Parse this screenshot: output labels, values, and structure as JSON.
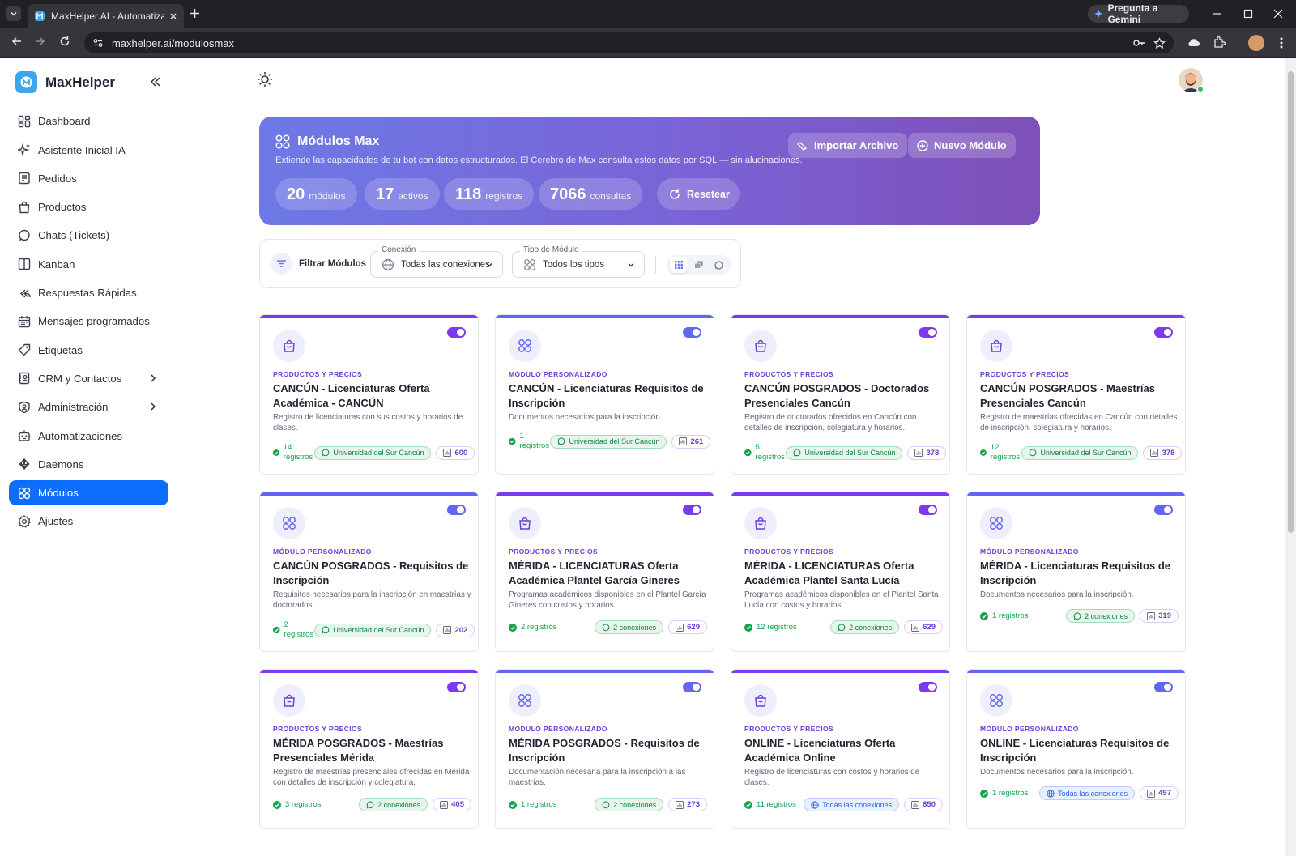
{
  "browser": {
    "tab_title": "MaxHelper.AI - Automatiza tu a",
    "url": "maxhelper.ai/modulosmax",
    "gemini_label": "Pregunta a Gemini"
  },
  "app": {
    "name": "MaxHelper"
  },
  "sidebar": {
    "items": [
      {
        "label": "Dashboard",
        "icon": "dashboard-icon"
      },
      {
        "label": "Asistente Inicial IA",
        "icon": "sparkle-icon"
      },
      {
        "label": "Pedidos",
        "icon": "orders-icon"
      },
      {
        "label": "Productos",
        "icon": "bag-icon"
      },
      {
        "label": "Chats (Tickets)",
        "icon": "whatsapp-icon"
      },
      {
        "label": "Kanban",
        "icon": "kanban-icon"
      },
      {
        "label": "Respuestas Rápidas",
        "icon": "reply-all-icon"
      },
      {
        "label": "Mensajes programados",
        "icon": "calendar-icon"
      },
      {
        "label": "Etiquetas",
        "icon": "tag-icon"
      },
      {
        "label": "CRM y Contactos",
        "icon": "contacts-icon"
      },
      {
        "label": "Administración",
        "icon": "admin-icon"
      },
      {
        "label": "Automatizaciones",
        "icon": "robot-icon"
      },
      {
        "label": "Daemons",
        "icon": "daemon-icon"
      },
      {
        "label": "Módulos",
        "icon": "modules-icon"
      },
      {
        "label": "Ajustes",
        "icon": "settings-icon"
      }
    ]
  },
  "hero": {
    "title": "Módulos Max",
    "subtitle": "Extiende las capacidades de tu bot con datos estructurados. El Cerebro de Max consulta estos datos por SQL — sin alucinaciones.",
    "import_label": "Importar Archivo",
    "new_label": "Nuevo Módulo",
    "stats": [
      {
        "value": "20",
        "unit": "módulos"
      },
      {
        "value": "17",
        "unit": "activos"
      },
      {
        "value": "118",
        "unit": "registros"
      },
      {
        "value": "7066",
        "unit": "consultas"
      }
    ],
    "reset_label": "Resetear"
  },
  "filters": {
    "label": "Filtrar Módulos",
    "connection_legend": "Conexión",
    "connection_value": "Todas las conexiones",
    "type_legend": "Tipo de Módulo",
    "type_value": "Todos los tipos"
  },
  "colors": {
    "primary": "#0d6efd",
    "purple": "#6d3fd6",
    "indigo": "#6366f1",
    "green": "#16a34a"
  },
  "cards": [
    {
      "type": "PRODUCTOS Y PRECIOS",
      "title": "CANCÚN - Licenciaturas Oferta Académica - CANCÚN",
      "desc": "Registro de licenciaturas con sus costos y horarios de clases.",
      "registros": "14 registros",
      "conexion": "Universidad del Sur Cancún",
      "conexion_kind": "wa",
      "count": "600",
      "icon": "bag-icon"
    },
    {
      "type": "MÓDULO PERSONALIZADO",
      "title": "CANCÚN - Licenciaturas Requisitos de Inscripción",
      "desc": "Documentos necesarios para la inscripción.",
      "registros": "1 registros",
      "conexion": "Universidad del Sur Cancún",
      "conexion_kind": "wa",
      "count": "261",
      "icon": "modules-icon"
    },
    {
      "type": "PRODUCTOS Y PRECIOS",
      "title": "CANCÚN POSGRADOS - Doctorados Presenciales Cancún",
      "desc": "Registro de doctorados ofrecidos en Cancún con detalles de inscripción, colegiatura y horarios.",
      "registros": "5 registros",
      "conexion": "Universidad del Sur Cancún",
      "conexion_kind": "wa",
      "count": "378",
      "icon": "bag-icon"
    },
    {
      "type": "PRODUCTOS Y PRECIOS",
      "title": "CANCÚN POSGRADOS - Maestrías Presenciales Cancún",
      "desc": "Registro de maestrías ofrecidas en Cancún con detalles de inscripción, colegiatura y horarios.",
      "registros": "12 registros",
      "conexion": "Universidad del Sur Cancún",
      "conexion_kind": "wa",
      "count": "378",
      "icon": "bag-icon"
    },
    {
      "type": "MÓDULO PERSONALIZADO",
      "title": "CANCÚN POSGRADOS - Requisitos de Inscripción",
      "desc": "Requisitos necesarios para la inscripción en maestrías y doctorados.",
      "registros": "2 registros",
      "conexion": "Universidad del Sur Cancún",
      "conexion_kind": "wa",
      "count": "202",
      "icon": "modules-icon"
    },
    {
      "type": "PRODUCTOS Y PRECIOS",
      "title": "MÉRIDA - LICENCIATURAS Oferta Académica Plantel García Gineres",
      "desc": "Programas académicos disponibles en el Plantel García Gineres con costos y horarios.",
      "registros": "2 registros",
      "conexion": "2 conexiones",
      "conexion_kind": "wa",
      "count": "629",
      "icon": "bag-icon"
    },
    {
      "type": "PRODUCTOS Y PRECIOS",
      "title": "MÉRIDA - LICENCIATURAS Oferta Académica Plantel Santa Lucía",
      "desc": "Programas académicos disponibles en el Plantel Santa Lucía con costos y horarios.",
      "registros": "12 registros",
      "conexion": "2 conexiones",
      "conexion_kind": "wa",
      "count": "629",
      "icon": "bag-icon"
    },
    {
      "type": "MÓDULO PERSONALIZADO",
      "title": "MÉRIDA - Licenciaturas Requisitos de Inscripción",
      "desc": "Documentos necesarios para la inscripción.",
      "registros": "1 registros",
      "conexion": "2 conexiones",
      "conexion_kind": "wa",
      "count": "319",
      "icon": "modules-icon"
    },
    {
      "type": "PRODUCTOS Y PRECIOS",
      "title": "MÉRIDA POSGRADOS - Maestrías Presenciales Mérida",
      "desc": "Registro de maestrías presenciales ofrecidas en Mérida con detalles de inscripción y colegiatura.",
      "registros": "3 registros",
      "conexion": "2 conexiones",
      "conexion_kind": "wa",
      "count": "405",
      "icon": "bag-icon"
    },
    {
      "type": "MÓDULO PERSONALIZADO",
      "title": "MÉRIDA POSGRADOS - Requisitos de Inscripción",
      "desc": "Documentación necesaria para la inscripción a las maestrías.",
      "registros": "1 registros",
      "conexion": "2 conexiones",
      "conexion_kind": "wa",
      "count": "273",
      "icon": "modules-icon"
    },
    {
      "type": "PRODUCTOS Y PRECIOS",
      "title": "ONLINE - Licenciaturas Oferta Académica Online",
      "desc": "Registro de licenciaturas con costos y horarios de clases.",
      "registros": "11 registros",
      "conexion": "Todas las conexiones",
      "conexion_kind": "web",
      "count": "850",
      "icon": "bag-icon"
    },
    {
      "type": "MÓDULO PERSONALIZADO",
      "title": "ONLINE - Licenciaturas Requisitos de Inscripción",
      "desc": "Documentos necesarios para la inscripción.",
      "registros": "1 registros",
      "conexion": "Todas las conexiones",
      "conexion_kind": "web",
      "count": "497",
      "icon": "modules-icon"
    }
  ]
}
